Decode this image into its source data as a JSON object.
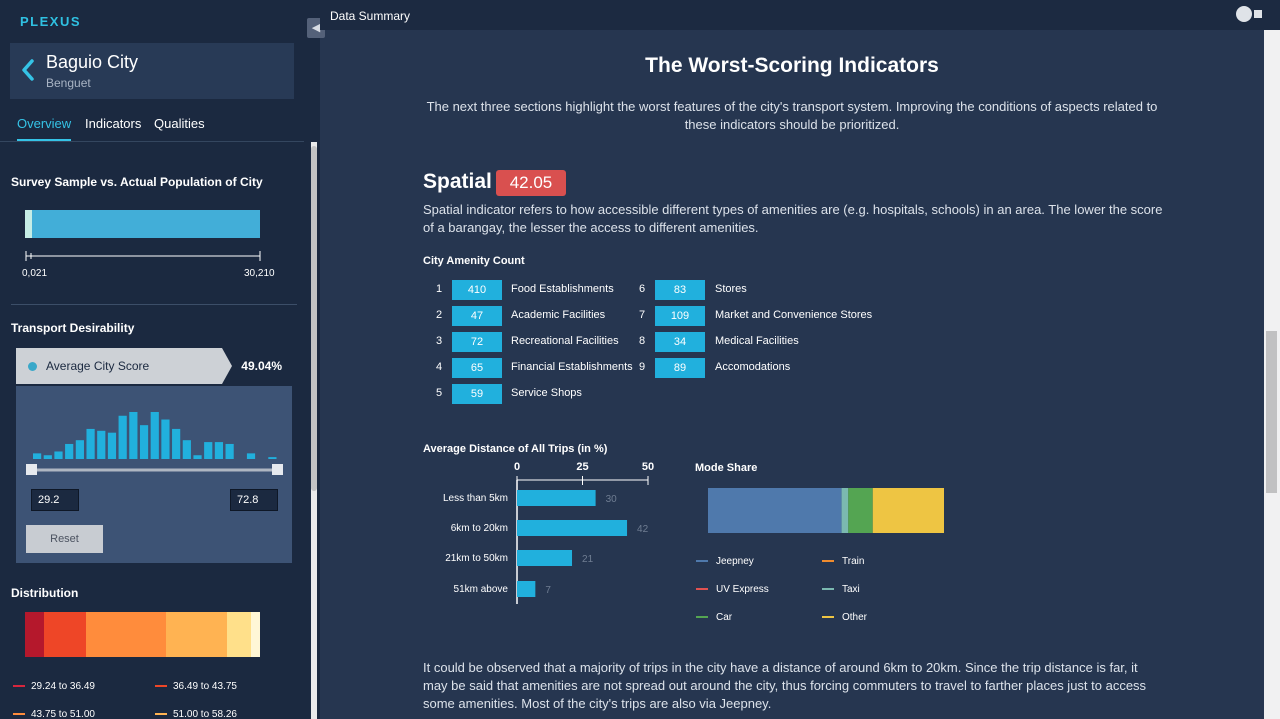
{
  "app": {
    "brand": "PLEXUS",
    "topbar_title": "Data Summary"
  },
  "city": {
    "name": "Baguio City",
    "province": "Benguet"
  },
  "tabs": [
    "Overview",
    "Indicators",
    "Qualities"
  ],
  "sidebar": {
    "population": {
      "title": "Survey Sample vs. Actual Population of City",
      "sample": "0,021",
      "actual": "30,210",
      "sample_fraction": 0.03
    },
    "desirability": {
      "title": "Transport Desirability",
      "score_label": "Average City Score",
      "score_value": "49.04%",
      "histogram": [
        3,
        2,
        4,
        8,
        10,
        16,
        15,
        14,
        23,
        25,
        18,
        25,
        21,
        16,
        10,
        2,
        9,
        9,
        8,
        0,
        3,
        0,
        1
      ],
      "range_min": "29.2",
      "range_max": "72.8",
      "reset_label": "Reset"
    },
    "distribution": {
      "title": "Distribution",
      "segments": [
        {
          "color": "#b5182c",
          "weight": 8
        },
        {
          "color": "#ee4627",
          "weight": 18
        },
        {
          "color": "#ff8c3c",
          "weight": 34
        },
        {
          "color": "#ffb352",
          "weight": 26
        },
        {
          "color": "#ffe08a",
          "weight": 10
        },
        {
          "color": "#fff7d6",
          "weight": 4
        }
      ],
      "legend": [
        {
          "label": "29.24 to 36.49",
          "color": "#d7263d"
        },
        {
          "label": "36.49 to 43.75",
          "color": "#ee4627"
        },
        {
          "label": "43.75 to 51.00",
          "color": "#ff8c3c"
        },
        {
          "label": "51.00 to 58.26",
          "color": "#ffb352"
        }
      ]
    }
  },
  "main": {
    "title": "The Worst-Scoring Indicators",
    "intro": "The next three sections highlight the worst features of the city's transport system. Improving the conditions of aspects related to these indicators should be prioritized.",
    "spatial": {
      "heading": "Spatial",
      "score": "42.05",
      "description": "Spatial indicator refers to how accessible different types of amenities are (e.g. hospitals, schools) in an area. The lower the score of a barangay, the lesser the access to different amenities."
    },
    "amenity_title": "City Amenity Count",
    "amenities": [
      {
        "idx": "1",
        "count": "410",
        "name": "Food Establishments"
      },
      {
        "idx": "2",
        "count": "47",
        "name": "Academic Facilities"
      },
      {
        "idx": "3",
        "count": "72",
        "name": "Recreational Facilities"
      },
      {
        "idx": "4",
        "count": "65",
        "name": "Financial Establishments"
      },
      {
        "idx": "5",
        "count": "59",
        "name": "Service Shops"
      },
      {
        "idx": "6",
        "count": "83",
        "name": "Stores"
      },
      {
        "idx": "7",
        "count": "109",
        "name": "Market and Convenience Stores"
      },
      {
        "idx": "8",
        "count": "34",
        "name": "Medical Facilities"
      },
      {
        "idx": "9",
        "count": "89",
        "name": "Accomodations"
      }
    ],
    "conclusion": "It could be observed that a majority of trips in the city have a distance of around 6km to 20km. Since the trip distance is far, it may be said that amenities are not spread out around the city, thus forcing commuters to travel to farther places just to access some amenities. Most of the city's trips are also via Jeepney."
  },
  "chart_data": [
    {
      "type": "bar",
      "orientation": "horizontal",
      "title": "Average Distance of All Trips (in %)",
      "categories": [
        "Less than 5km",
        "6km to 20km",
        "21km to 50km",
        "51km above"
      ],
      "values": [
        30,
        42,
        21,
        7
      ],
      "xlim": [
        0,
        50
      ],
      "xticks": [
        0,
        25,
        50
      ],
      "color": "#21b0dd"
    },
    {
      "type": "bar",
      "orientation": "stacked-horizontal",
      "title": "Mode Share",
      "series": [
        {
          "name": "Jeepney",
          "value": 60,
          "color": "#4f79ac"
        },
        {
          "name": "Train",
          "value": 0,
          "color": "#f08c2e"
        },
        {
          "name": "UV Express",
          "value": 0,
          "color": "#e05251"
        },
        {
          "name": "Taxi",
          "value": 3,
          "color": "#7bb9b0"
        },
        {
          "name": "Car",
          "value": 11,
          "color": "#54a552"
        },
        {
          "name": "Other",
          "value": 32,
          "color": "#eec543"
        }
      ]
    }
  ]
}
